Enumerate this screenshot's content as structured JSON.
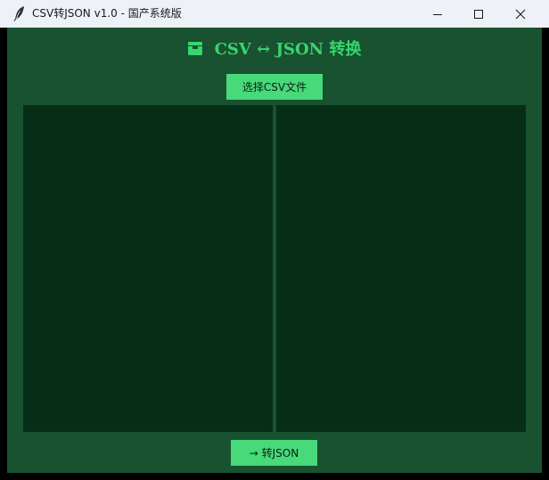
{
  "window": {
    "title": "CSV转JSON  v1.0  -  国产系统版",
    "app_icon": "feather-icon",
    "controls": [
      "minimize-icon",
      "maximize-icon",
      "close-icon"
    ]
  },
  "header": {
    "icon": "package-icon",
    "title": "CSV ↔ JSON 转换"
  },
  "actions": {
    "select_label": "选择CSV文件",
    "convert_label": "→ 转JSON"
  },
  "panes": {
    "csv_text": "",
    "json_text": ""
  },
  "colors": {
    "background": "#185230",
    "pane": "#062e17",
    "accent": "#47d97a",
    "heading": "#37d66f"
  }
}
